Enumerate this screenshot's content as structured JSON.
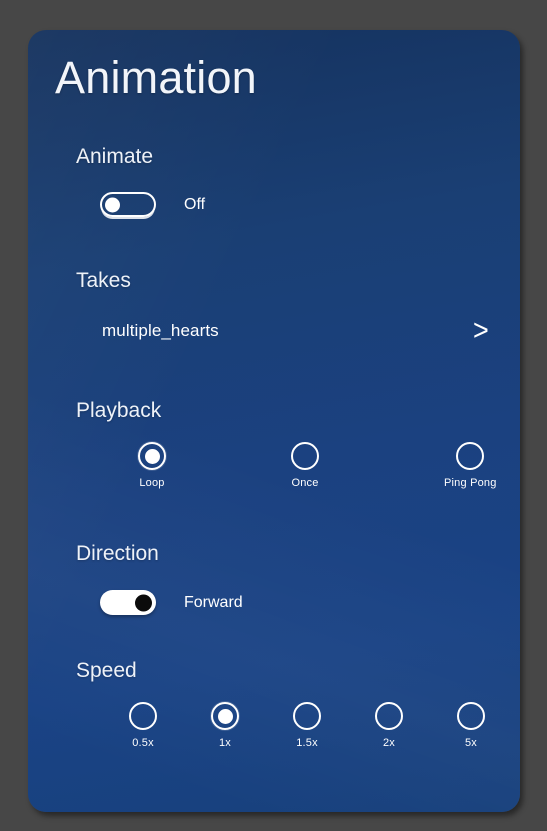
{
  "panel": {
    "title": "Animation",
    "background_color": "#1a3f78",
    "page_background_color": "#474747"
  },
  "animate": {
    "section_title": "Animate",
    "toggle": {
      "state": "off",
      "label": "Off",
      "icon": "toggle-off-icon"
    }
  },
  "takes": {
    "section_title": "Takes",
    "value": "multiple_hearts",
    "chevron": ">",
    "chevron_icon": "chevron-right-icon"
  },
  "playback": {
    "section_title": "Playback",
    "selected": "Loop",
    "options": [
      {
        "label": "Loop",
        "selected": true
      },
      {
        "label": "Once",
        "selected": false
      },
      {
        "label": "Ping Pong",
        "selected": false
      }
    ]
  },
  "direction": {
    "section_title": "Direction",
    "toggle": {
      "state": "on",
      "label": "Forward",
      "icon": "toggle-on-icon"
    }
  },
  "speed": {
    "section_title": "Speed",
    "selected": "1x",
    "options": [
      {
        "label": "0.5x",
        "selected": false
      },
      {
        "label": "1x",
        "selected": true
      },
      {
        "label": "1.5x",
        "selected": false
      },
      {
        "label": "2x",
        "selected": false
      },
      {
        "label": "5x",
        "selected": false
      }
    ]
  }
}
